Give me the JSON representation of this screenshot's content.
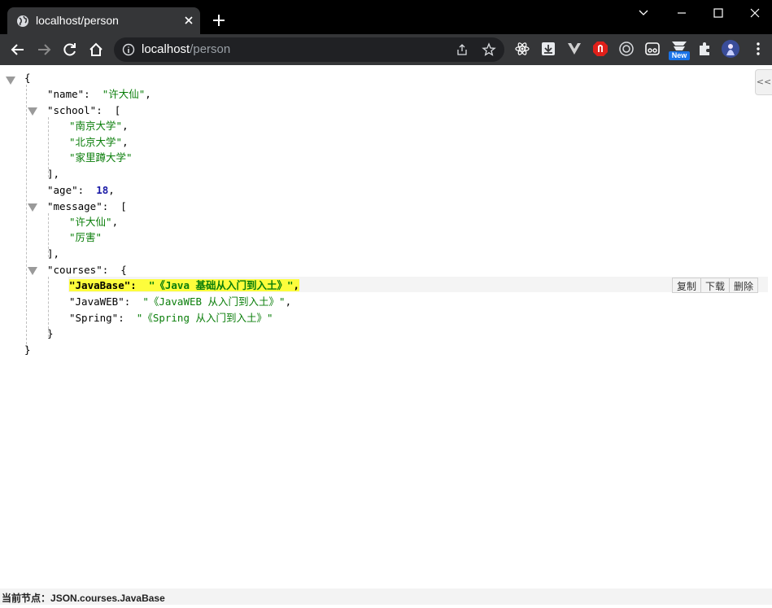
{
  "tab": {
    "title": "localhost/person"
  },
  "address": {
    "host": "localhost",
    "path": "/person"
  },
  "toolbar": {
    "extensions": [
      "react-icon",
      "download-icon",
      "vue-icon",
      "adblock-icon",
      "radio-icon",
      "reader-icon",
      "new-badge-icon",
      "puzzle-icon",
      "avatar",
      "menu-icon"
    ],
    "new_badge": "New"
  },
  "json_view": {
    "open_brace": "{",
    "close_brace": "}",
    "name_key": "\"name\"",
    "name_value": "\"许大仙\"",
    "school_key": "\"school\"",
    "school_values": [
      "\"南京大学\"",
      "\"北京大学\"",
      "\"家里蹲大学\""
    ],
    "age_key": "\"age\"",
    "age_value": "18",
    "message_key": "\"message\"",
    "message_values": [
      "\"许大仙\"",
      "\"厉害\""
    ],
    "courses_key": "\"courses\"",
    "courses": [
      {
        "key": "\"JavaBase\"",
        "value": "\"《Java 基础从入门到入土》\""
      },
      {
        "key": "\"JavaWEB\"",
        "value": "\"《JavaWEB 从入门到入土》\""
      },
      {
        "key": "\"Spring\"",
        "value": "\"《Spring 从入门到入土》\""
      }
    ]
  },
  "row_actions": {
    "copy": "复制",
    "download": "下载",
    "delete": "删除"
  },
  "side_collapse": "<<",
  "status": {
    "label": "当前节点：",
    "path": "JSON.courses.JavaBase"
  },
  "colors": {
    "string": "#0a7e0a",
    "number": "#1a1aa6",
    "highlight": "#fdfd3c",
    "chrome_dark": "#353638"
  }
}
